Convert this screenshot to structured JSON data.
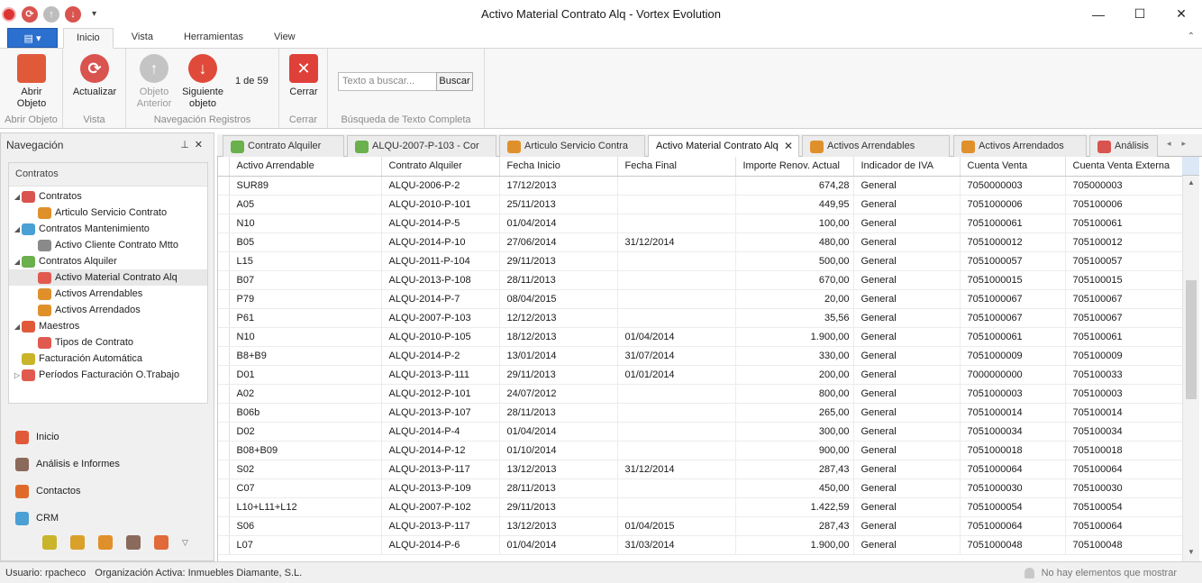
{
  "window": {
    "title": "Activo Material Contrato Alq - Vortex Evolution",
    "controls": [
      "—",
      "☐",
      "✕"
    ]
  },
  "ribbon_tabs": [
    "Inicio",
    "Vista",
    "Herramientas",
    "View"
  ],
  "ribbon": {
    "abrir": {
      "label1": "Abrir",
      "label2": "Objeto",
      "group": "Abrir Objeto"
    },
    "actualizar": {
      "label": "Actualizar",
      "group": "Vista"
    },
    "anterior": {
      "label1": "Objeto",
      "label2": "Anterior"
    },
    "siguiente": {
      "label1": "Siguiente",
      "label2": "objeto"
    },
    "counter": "1 de 59",
    "nav_group": "Navegación Registros",
    "cerrar": {
      "label": "Cerrar",
      "group": "Cerrar"
    },
    "search": {
      "placeholder": "Texto a buscar...",
      "button": "Buscar",
      "group": "Búsqueda de Texto Completa"
    }
  },
  "nav": {
    "title": "Navegación",
    "section": "Contratos",
    "tree": [
      {
        "label": "Contratos",
        "level": 0,
        "exp": "◢",
        "color": "#d9534f"
      },
      {
        "label": "Articulo Servicio Contrato",
        "level": 1,
        "exp": "",
        "color": "#e0902a"
      },
      {
        "label": "Contratos Mantenimiento",
        "level": 0,
        "exp": "◢",
        "color": "#4a9fd4"
      },
      {
        "label": "Activo Cliente Contrato Mtto",
        "level": 1,
        "exp": "",
        "color": "#8a8a8a"
      },
      {
        "label": "Contratos Alquiler",
        "level": 0,
        "exp": "◢",
        "color": "#6ab04c"
      },
      {
        "label": "Activo Material Contrato Alq",
        "level": 1,
        "exp": "",
        "color": "#e05a4f",
        "selected": true
      },
      {
        "label": "Activos Arrendables",
        "level": 1,
        "exp": "",
        "color": "#e0902a"
      },
      {
        "label": "Activos Arrendados",
        "level": 1,
        "exp": "",
        "color": "#e0902a"
      },
      {
        "label": "Maestros",
        "level": 0,
        "exp": "◢",
        "color": "#e05a3a"
      },
      {
        "label": "Tipos de Contrato",
        "level": 1,
        "exp": "",
        "color": "#e05a4f"
      },
      {
        "label": "Facturación Automática",
        "level": 0,
        "exp": "",
        "color": "#c9b42a"
      },
      {
        "label": "Períodos Facturación O.Trabajo",
        "level": 0,
        "exp": "▷",
        "color": "#e05a4f"
      }
    ],
    "buttons": [
      {
        "label": "Inicio",
        "color": "#e05a3a"
      },
      {
        "label": "Análisis e Informes",
        "color": "#8a6a5a"
      },
      {
        "label": "Contactos",
        "color": "#e06a2a"
      },
      {
        "label": "CRM",
        "color": "#4a9fd4"
      }
    ]
  },
  "doc_tabs": [
    {
      "label": "Contrato Alquiler",
      "color": "#6ab04c"
    },
    {
      "label": "ALQU-2007-P-103 - Cor",
      "color": "#6ab04c"
    },
    {
      "label": "Articulo Servicio Contra",
      "color": "#e0902a"
    },
    {
      "label": "Activo Material Contrato Alq",
      "color": "",
      "active": true
    },
    {
      "label": "Activos Arrendables",
      "color": "#e0902a"
    },
    {
      "label": "Activos Arrendados",
      "color": "#e0902a"
    },
    {
      "label": "Análisis",
      "color": "#d9534f"
    }
  ],
  "grid": {
    "columns": [
      "Activo Arrendable",
      "Contrato Alquiler",
      "Fecha Inicio",
      "Fecha Final",
      "Importe Renov. Actual",
      "Indicador de IVA",
      "Cuenta Venta",
      "Cuenta Venta Externa"
    ],
    "rows": [
      [
        "SUR89",
        "ALQU-2006-P-2",
        "17/12/2013",
        "",
        "674,28",
        "General",
        "7050000003",
        "705000003"
      ],
      [
        "A05",
        "ALQU-2010-P-101",
        "25/11/2013",
        "",
        "449,95",
        "General",
        "7051000006",
        "705100006"
      ],
      [
        "N10",
        "ALQU-2014-P-5",
        "01/04/2014",
        "",
        "100,00",
        "General",
        "7051000061",
        "705100061"
      ],
      [
        "B05",
        "ALQU-2014-P-10",
        "27/06/2014",
        "31/12/2014",
        "480,00",
        "General",
        "7051000012",
        "705100012"
      ],
      [
        "L15",
        "ALQU-2011-P-104",
        "29/11/2013",
        "",
        "500,00",
        "General",
        "7051000057",
        "705100057"
      ],
      [
        "B07",
        "ALQU-2013-P-108",
        "28/11/2013",
        "",
        "670,00",
        "General",
        "7051000015",
        "705100015"
      ],
      [
        "P79",
        "ALQU-2014-P-7",
        "08/04/2015",
        "",
        "20,00",
        "General",
        "7051000067",
        "705100067"
      ],
      [
        "P61",
        "ALQU-2007-P-103",
        "12/12/2013",
        "",
        "35,56",
        "General",
        "7051000067",
        "705100067"
      ],
      [
        "N10",
        "ALQU-2010-P-105",
        "18/12/2013",
        "01/04/2014",
        "1.900,00",
        "General",
        "7051000061",
        "705100061"
      ],
      [
        "B8+B9",
        "ALQU-2014-P-2",
        "13/01/2014",
        "31/07/2014",
        "330,00",
        "General",
        "7051000009",
        "705100009"
      ],
      [
        "D01",
        "ALQU-2013-P-111",
        "29/11/2013",
        "01/01/2014",
        "200,00",
        "General",
        "7000000000",
        "705100033"
      ],
      [
        "A02",
        "ALQU-2012-P-101",
        "24/07/2012",
        "",
        "800,00",
        "General",
        "7051000003",
        "705100003"
      ],
      [
        "B06b",
        "ALQU-2013-P-107",
        "28/11/2013",
        "",
        "265,00",
        "General",
        "7051000014",
        "705100014"
      ],
      [
        "D02",
        "ALQU-2014-P-4",
        "01/04/2014",
        "",
        "300,00",
        "General",
        "7051000034",
        "705100034"
      ],
      [
        "B08+B09",
        "ALQU-2014-P-12",
        "01/10/2014",
        "",
        "900,00",
        "General",
        "7051000018",
        "705100018"
      ],
      [
        "S02",
        "ALQU-2013-P-117",
        "13/12/2013",
        "31/12/2014",
        "287,43",
        "General",
        "7051000064",
        "705100064"
      ],
      [
        "C07",
        "ALQU-2013-P-109",
        "28/11/2013",
        "",
        "450,00",
        "General",
        "7051000030",
        "705100030"
      ],
      [
        "L10+L11+L12",
        "ALQU-2007-P-102",
        "29/11/2013",
        "",
        "1.422,59",
        "General",
        "7051000054",
        "705100054"
      ],
      [
        "S06",
        "ALQU-2013-P-117",
        "13/12/2013",
        "01/04/2015",
        "287,43",
        "General",
        "7051000064",
        "705100064"
      ],
      [
        "L07",
        "ALQU-2014-P-6",
        "01/04/2014",
        "31/03/2014",
        "1.900,00",
        "General",
        "7051000048",
        "705100048"
      ]
    ]
  },
  "status": {
    "user": "Usuario: rpacheco",
    "org": "Organización Activa: Inmuebles Diamante, S.L.",
    "notifications": "No hay elementos que mostrar"
  }
}
